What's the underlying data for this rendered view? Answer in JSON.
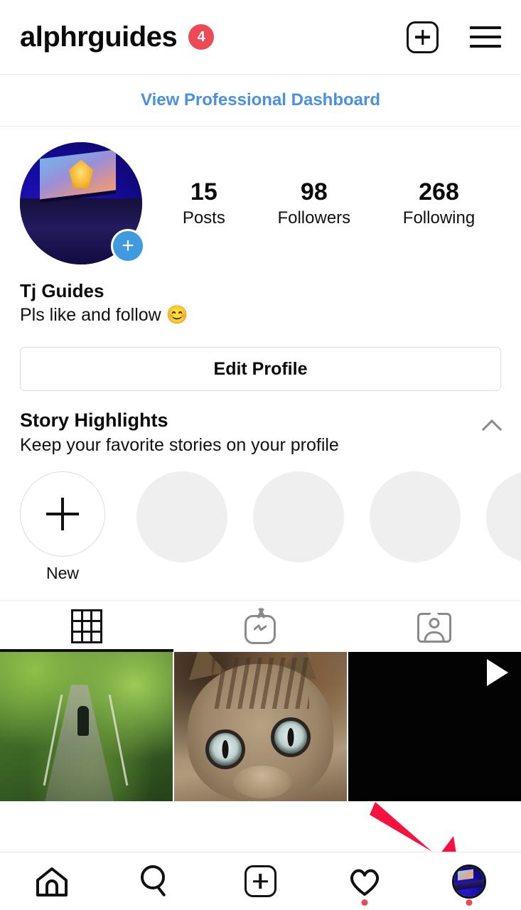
{
  "header": {
    "username": "alphrguides",
    "badge_count": "4",
    "add_icon": "plus-square-icon",
    "menu_icon": "hamburger-menu-icon"
  },
  "professional_dashboard": {
    "label": "View Professional Dashboard",
    "color": "#4a90e2"
  },
  "profile": {
    "avatar_alt": "profile-picture",
    "add_story_icon": "plus-icon",
    "stats": [
      {
        "value": "15",
        "label": "Posts"
      },
      {
        "value": "98",
        "label": "Followers"
      },
      {
        "value": "268",
        "label": "Following"
      }
    ],
    "name": "Tj Guides",
    "bio": "Pls like and follow 😊",
    "edit_button": "Edit Profile"
  },
  "story_highlights": {
    "title": "Story Highlights",
    "subtitle": "Keep your favorite stories on your profile",
    "collapse_icon": "chevron-up-icon",
    "new_label": "New",
    "placeholder_count": 4
  },
  "tabs": [
    {
      "name": "grid-tab",
      "icon": "grid-icon",
      "active": true
    },
    {
      "name": "igtv-tab",
      "icon": "igtv-icon",
      "active": false
    },
    {
      "name": "tagged-tab",
      "icon": "tagged-icon",
      "active": false
    }
  ],
  "posts": [
    {
      "name": "post-jungle-bridge",
      "type": "photo",
      "alt": "jungle suspension bridge"
    },
    {
      "name": "post-cat",
      "type": "photo",
      "alt": "close-up of tabby kitten"
    },
    {
      "name": "post-video",
      "type": "video",
      "alt": "dark video thumbnail",
      "overlay_icon": "play-icon"
    }
  ],
  "annotation": {
    "type": "arrow",
    "color": "#f7113f",
    "points_to": "profile-nav-avatar"
  },
  "bottom_nav": [
    {
      "name": "nav-home",
      "icon": "home-icon",
      "has_dot": false
    },
    {
      "name": "nav-search",
      "icon": "search-icon",
      "has_dot": false
    },
    {
      "name": "nav-add",
      "icon": "plus-square-icon",
      "has_dot": false
    },
    {
      "name": "nav-activity",
      "icon": "heart-icon",
      "has_dot": true
    },
    {
      "name": "nav-profile",
      "icon": "avatar-icon",
      "has_dot": true
    }
  ]
}
